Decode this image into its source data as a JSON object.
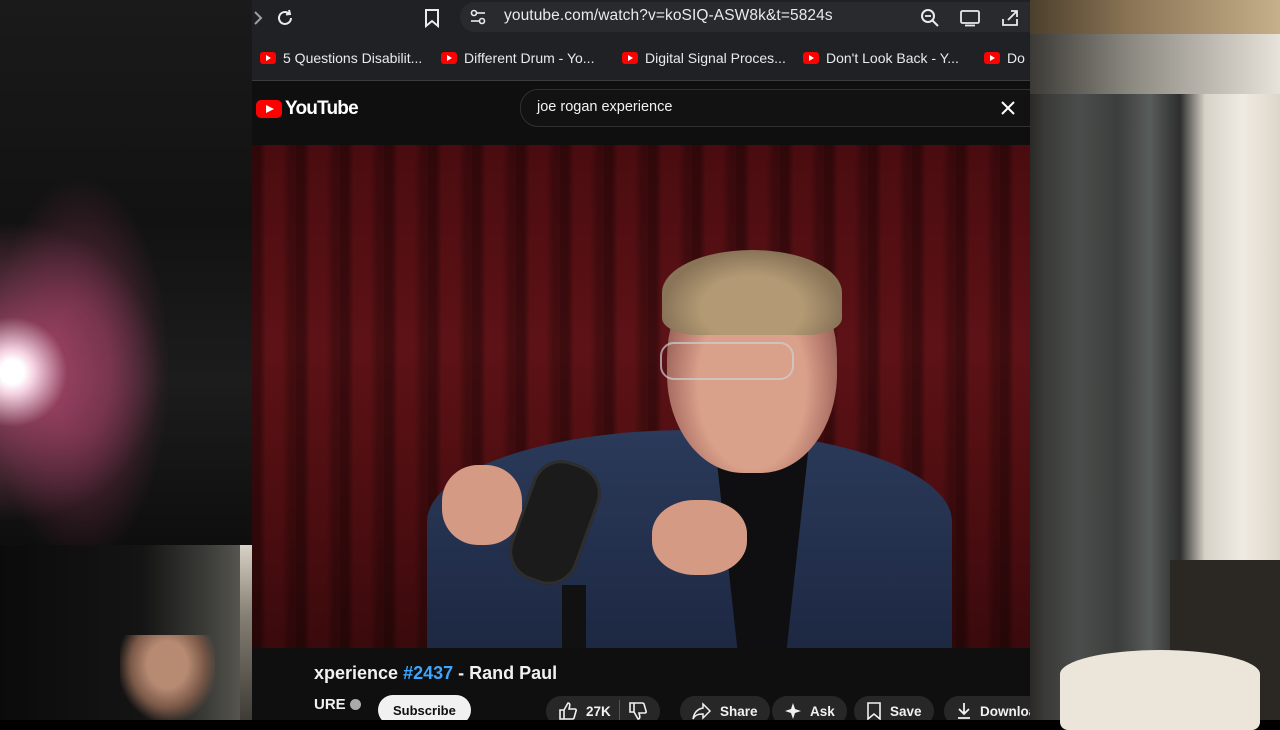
{
  "browser": {
    "url": "youtube.com/watch?v=koSIQ-ASW8k&t=5824s",
    "bookmarks": [
      {
        "label": "5 Questions Disabilit..."
      },
      {
        "label": "Different Drum - Yo..."
      },
      {
        "label": "Digital Signal Proces..."
      },
      {
        "label": "Don't Look Back - Y..."
      },
      {
        "label": "Do"
      }
    ]
  },
  "youtube": {
    "logo_text": "YouTube",
    "search_query": "joe rogan experience",
    "video": {
      "title_prefix": "xperience ",
      "title_tag": "#2437",
      "title_suffix": " - Rand Paul",
      "channel": "URE",
      "subscribe_label": "Subscribe",
      "likes": "27K",
      "share_label": "Share",
      "ask_label": "Ask",
      "save_label": "Save",
      "download_label": "Download"
    }
  },
  "colors": {
    "youtube_red": "#ff0000",
    "hashtag_blue": "#3ea6ff",
    "page_bg": "#0f0f0f"
  }
}
